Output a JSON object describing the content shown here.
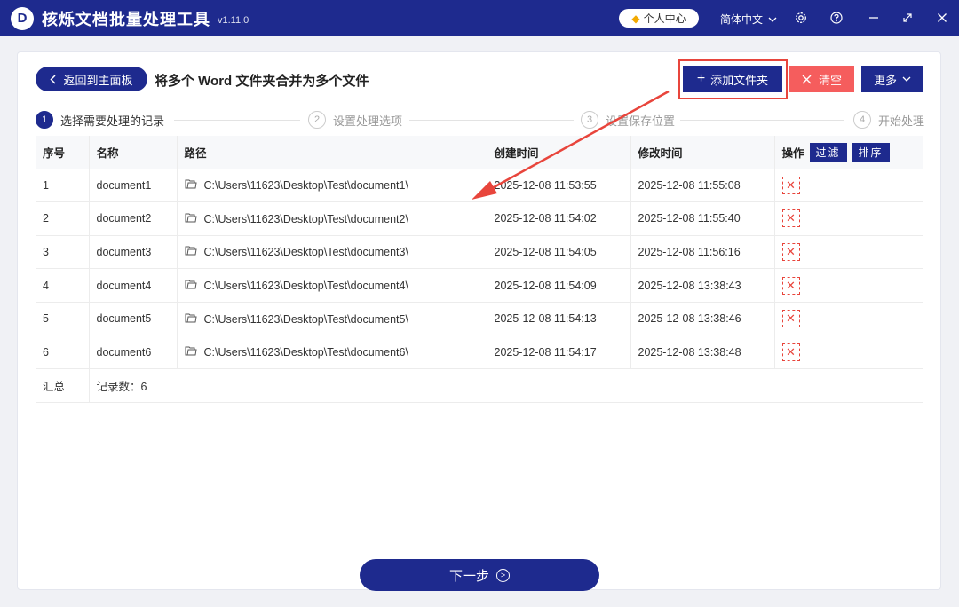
{
  "app": {
    "title": "核烁文档批量处理工具",
    "version": "v1.11.0",
    "logo_letter": "D",
    "user_center": "个人中心",
    "language": "简体中文"
  },
  "toolbar": {
    "back_label": "返回到主面板",
    "page_title": "将多个 Word 文件夹合并为多个文件",
    "add_folder_label": "添加文件夹",
    "clear_label": "清空",
    "more_label": "更多"
  },
  "steps": [
    {
      "num": "1",
      "label": "选择需要处理的记录"
    },
    {
      "num": "2",
      "label": "设置处理选项"
    },
    {
      "num": "3",
      "label": "设置保存位置"
    },
    {
      "num": "4",
      "label": "开始处理"
    }
  ],
  "table": {
    "headers": {
      "index": "序号",
      "name": "名称",
      "path": "路径",
      "created": "创建时间",
      "modified": "修改时间",
      "operation": "操作",
      "filter": "过滤",
      "sort": "排序"
    },
    "rows": [
      {
        "index": "1",
        "name": "document1",
        "path": "C:\\Users\\11623\\Desktop\\Test\\document1\\",
        "created": "2025-12-08 11:53:55",
        "modified": "2025-12-08 11:55:08"
      },
      {
        "index": "2",
        "name": "document2",
        "path": "C:\\Users\\11623\\Desktop\\Test\\document2\\",
        "created": "2025-12-08 11:54:02",
        "modified": "2025-12-08 11:55:40"
      },
      {
        "index": "3",
        "name": "document3",
        "path": "C:\\Users\\11623\\Desktop\\Test\\document3\\",
        "created": "2025-12-08 11:54:05",
        "modified": "2025-12-08 11:56:16"
      },
      {
        "index": "4",
        "name": "document4",
        "path": "C:\\Users\\11623\\Desktop\\Test\\document4\\",
        "created": "2025-12-08 11:54:09",
        "modified": "2025-12-08 13:38:43"
      },
      {
        "index": "5",
        "name": "document5",
        "path": "C:\\Users\\11623\\Desktop\\Test\\document5\\",
        "created": "2025-12-08 11:54:13",
        "modified": "2025-12-08 13:38:46"
      },
      {
        "index": "6",
        "name": "document6",
        "path": "C:\\Users\\11623\\Desktop\\Test\\document6\\",
        "created": "2025-12-08 11:54:17",
        "modified": "2025-12-08 13:38:48"
      }
    ],
    "summary_label": "汇总",
    "summary_count": "记录数：6"
  },
  "footer": {
    "next_label": "下一步"
  },
  "colors": {
    "primary": "#1e2a8e",
    "danger": "#f55d5d",
    "highlight": "#e8453c"
  }
}
